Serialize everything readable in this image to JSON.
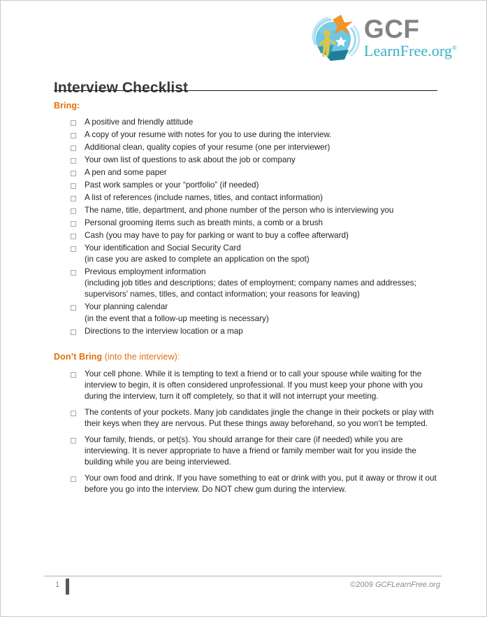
{
  "document": {
    "title": "Interview Checklist"
  },
  "logo": {
    "mark_name": "gcf-globe-logo",
    "primary_text": "GCF",
    "secondary_text": "LearnFree.org",
    "registered_mark": "®",
    "colors": {
      "globe_blue": "#6ec6e0",
      "globe_light": "#bfe6f2",
      "star_orange": "#f0942b",
      "figure_yellow": "#d9c64a",
      "teal_dark": "#1f7f96",
      "gcf_gray": "#808285",
      "learnfree_teal": "#36b0c9"
    }
  },
  "theme": {
    "accent_orange": "#e2710c",
    "body_text": "#252525",
    "title_text": "#3a3a3c",
    "checkbox_border": "#a6a6a6",
    "footer_text": "#8a8a8a"
  },
  "sections": [
    {
      "id": "bring",
      "heading_strong": "Bring:",
      "heading_light": "",
      "items": [
        {
          "text": "A positive and friendly attitude",
          "sub": ""
        },
        {
          "text": "A copy of your resume with notes for you to use during the interview.",
          "sub": ""
        },
        {
          "text": "Additional clean, quality copies of your resume (one per interviewer)",
          "sub": ""
        },
        {
          "text": "Your own list of questions to ask about the job or company",
          "sub": ""
        },
        {
          "text": "A pen and some paper",
          "sub": ""
        },
        {
          "text": "Past work samples or your “portfolio” (if needed)",
          "sub": ""
        },
        {
          "text": "A list of references (include names, titles, and contact information)",
          "sub": ""
        },
        {
          "text": "The name, title, department, and phone number of the person who is interviewing you",
          "sub": ""
        },
        {
          "text": "Personal grooming items such as breath mints, a comb or a brush",
          "sub": ""
        },
        {
          "text": "Cash (you may have to pay for parking or want to buy a coffee afterward)",
          "sub": ""
        },
        {
          "text": "Your identification and Social Security Card",
          "sub": "(in case you are asked to complete an application on the spot)"
        },
        {
          "text": "Previous employment information",
          "sub": "(including job titles and descriptions; dates of employment; company names and addresses; supervisors’ names, titles, and contact information; your reasons for leaving)"
        },
        {
          "text": "Your planning calendar",
          "sub": "(in the event that a follow-up meeting is necessary)"
        },
        {
          "text": "Directions to the interview location or a map",
          "sub": ""
        }
      ]
    },
    {
      "id": "dont-bring",
      "heading_strong": "Don’t Bring",
      "heading_light": " (into the interview):",
      "items": [
        {
          "text": "Your cell phone. While it is tempting to text a friend or to call your spouse while waiting for the interview to begin, it is often considered unprofessional.  If you must keep your phone with you during the interview, turn it off completely, so that it will not interrupt your meeting.",
          "sub": ""
        },
        {
          "text": "The contents of your pockets. Many job candidates jingle the change in their pockets or play with their keys when they are nervous. Put these things away beforehand, so you won’t be tempted.",
          "sub": ""
        },
        {
          "text": "Your family, friends, or pet(s). You should arrange for their care (if needed) while you are interviewing.  It is never appropriate to have a friend or family member wait for you inside the building while you are being interviewed.",
          "sub": ""
        },
        {
          "text": "Your own food and drink. If you have something to eat or drink with you, put it away or throw it out before you go into the interview.  Do NOT chew gum during the interview.",
          "sub": ""
        }
      ]
    }
  ],
  "footer": {
    "page_number": "1",
    "copyright_prefix": "©2009 ",
    "copyright_brand": "GCFLearnFree.org"
  }
}
